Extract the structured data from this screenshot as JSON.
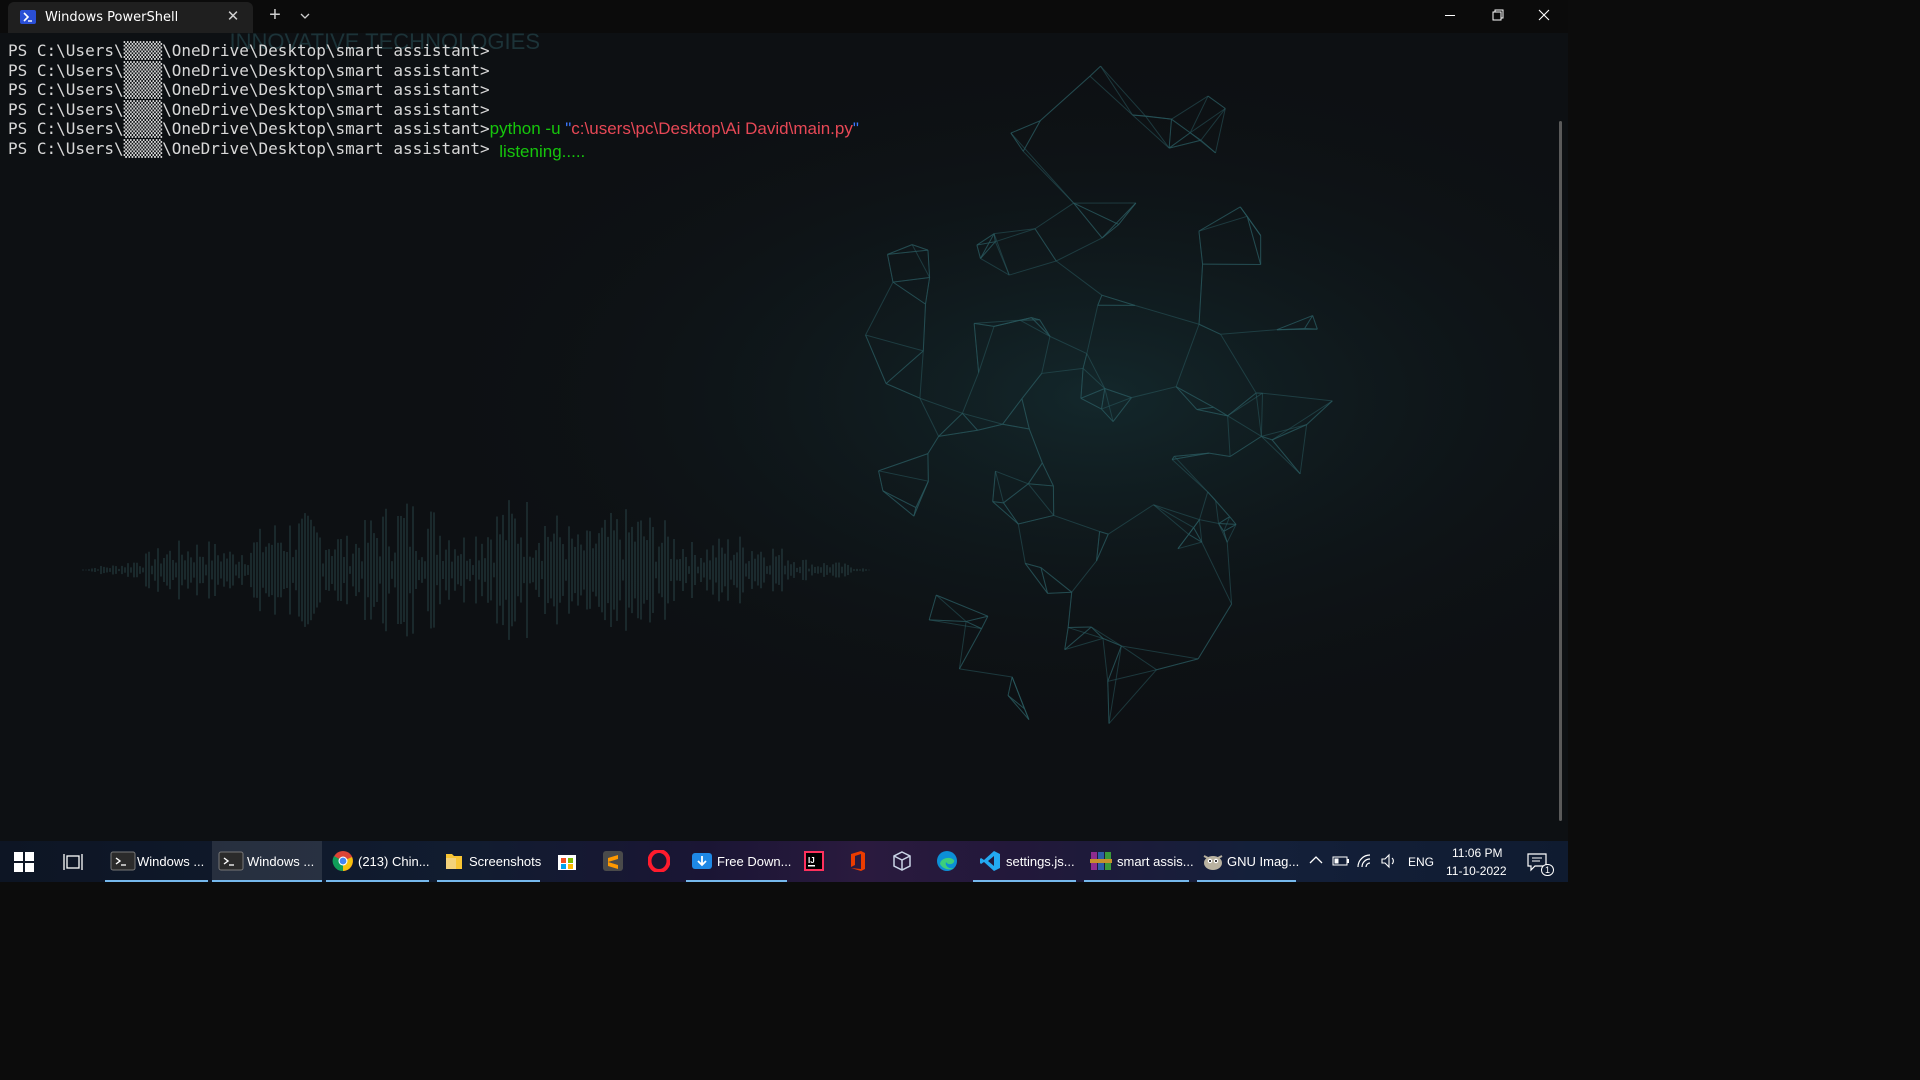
{
  "window": {
    "tab_title": "Windows PowerShell",
    "close_tab_glyph": "✕",
    "new_tab_glyph": "+"
  },
  "terminal": {
    "lines": [
      {
        "prompt": "PS C:\\Users\\▒▒▒▒\\OneDrive\\Desktop\\smart assistant>"
      },
      {
        "prompt": "PS C:\\Users\\▒▒▒▒\\OneDrive\\Desktop\\smart assistant>"
      },
      {
        "prompt": "PS C:\\Users\\▒▒▒▒\\OneDrive\\Desktop\\smart assistant>"
      },
      {
        "prompt": "PS C:\\Users\\▒▒▒▒\\OneDrive\\Desktop\\smart assistant>"
      },
      {
        "prompt": "PS C:\\Users\\▒▒▒▒\\OneDrive\\Desktop\\smart assistant>",
        "command": "python -u ",
        "quote_open": "\"",
        "path": "c:\\users\\pc\\Desktop\\Ai David\\main.py",
        "quote_close": "\""
      },
      {
        "prompt": "PS C:\\Users\\▒▒▒▒\\OneDrive\\Desktop\\smart assistant>",
        "output": "listening....."
      }
    ],
    "background_text": "INNOVATIVE TECHNOLOGIES"
  },
  "taskbar": {
    "items": [
      {
        "label": "Windows ...",
        "icon": "terminal-icon"
      },
      {
        "label": "Windows ...",
        "icon": "terminal-icon"
      },
      {
        "label": "(213) Chin...",
        "icon": "chrome-icon"
      },
      {
        "label": "Screenshots",
        "icon": "folder-icon"
      },
      {
        "label": "",
        "icon": "store-icon"
      },
      {
        "label": "",
        "icon": "sublime-icon"
      },
      {
        "label": "",
        "icon": "opera-icon"
      },
      {
        "label": "Free Down...",
        "icon": "download-manager-icon"
      },
      {
        "label": "",
        "icon": "intellij-icon"
      },
      {
        "label": "",
        "icon": "office-icon"
      },
      {
        "label": "",
        "icon": "virtualbox-icon"
      },
      {
        "label": "",
        "icon": "edge-icon"
      },
      {
        "label": "settings.js...",
        "icon": "vscode-icon"
      },
      {
        "label": "smart assis...",
        "icon": "winrar-icon"
      },
      {
        "label": "GNU Imag...",
        "icon": "gimp-icon"
      }
    ],
    "tray": {
      "language": "ENG",
      "time": "11:06 PM",
      "date": "11-10-2022",
      "notification_count": "1"
    }
  },
  "colors": {
    "prompt": "#d8d8d8",
    "command": "#16c60c",
    "string": "#e74856",
    "quote": "#3b78ff",
    "accent": "#76b9ed"
  }
}
